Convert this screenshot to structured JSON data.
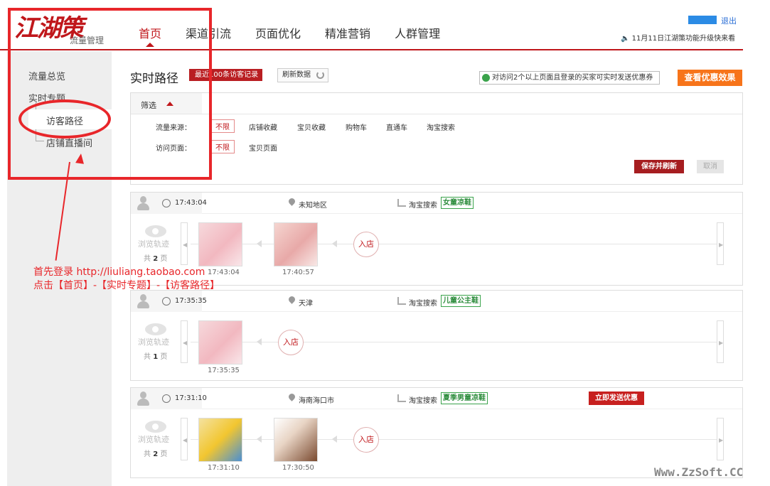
{
  "header": {
    "logo_text": "江湖策",
    "logo_sub": "流量管理",
    "nav": [
      "首页",
      "渠道引流",
      "页面优化",
      "精准营销",
      "人群管理"
    ],
    "logout": "退出",
    "notice": "11月11日江湖策功能升级快来看"
  },
  "sidebar": {
    "items": [
      "流量总览",
      "实时专题"
    ],
    "subitems": [
      "访客路径",
      "店铺直播间"
    ]
  },
  "toolbar": {
    "title": "实时路径",
    "tag": "最近100条访客记录",
    "refresh": "刷新数据",
    "promo_note": "对访问2个以上页面且登录的买家可实时发送优惠券",
    "promo_button": "查看优惠效果"
  },
  "filter": {
    "label": "筛选",
    "source_label": "流量来源：",
    "source_options": [
      "不限",
      "店铺收藏",
      "宝贝收藏",
      "购物车",
      "直通车",
      "淘宝搜索"
    ],
    "page_label": "访问页面：",
    "page_options": [
      "不限",
      "宝贝页面"
    ],
    "save": "保存并刷新",
    "cancel": "取消"
  },
  "common": {
    "track_label": "浏览轨迹",
    "enter_store": "入店",
    "page_prefix": "共",
    "page_suffix": "页",
    "send_button": "立即发送优惠"
  },
  "records": [
    {
      "time": "17:43:04",
      "region": "未知地区",
      "source": "淘宝搜索",
      "keyword": "女童凉鞋",
      "pages": "2",
      "thumb_times": [
        "17:43:04",
        "17:40:57"
      ]
    },
    {
      "time": "17:35:35",
      "region": "天津",
      "source": "淘宝搜索",
      "keyword": "儿童公主鞋",
      "pages": "1",
      "thumb_times": [
        "17:35:35"
      ]
    },
    {
      "time": "17:31:10",
      "region": "海南海口市",
      "source": "淘宝搜索",
      "keyword": "夏季男童凉鞋",
      "pages": "2",
      "thumb_times": [
        "17:31:10",
        "17:30:50"
      ]
    }
  ],
  "annotation": {
    "line1": "首先登录 http://liuliang.taobao.com",
    "line2": "点击【首页】-【实时专题】-【访客路径】"
  },
  "watermark": "Www.ZzSoft.CC",
  "colors": {
    "brand_red": "#c0171b",
    "orange": "#f7741a",
    "green": "#3aa34b",
    "annotation_red": "#e8262a"
  }
}
